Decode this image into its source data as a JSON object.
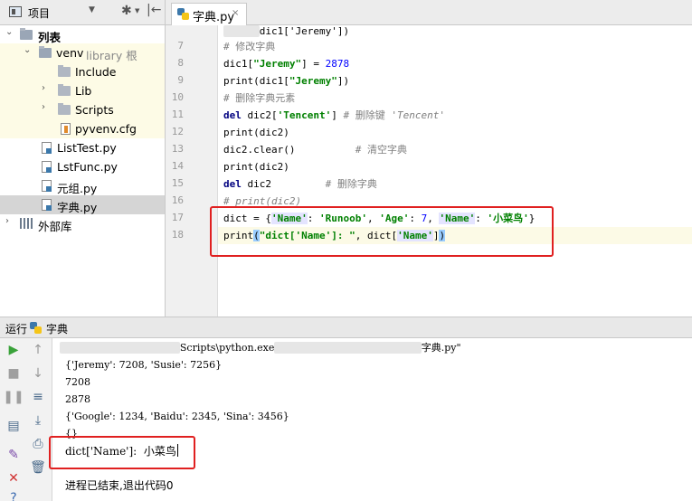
{
  "project_panel": {
    "title": "项目",
    "caret": "▼",
    "gear": "✱",
    "gear_caret": "▼",
    "pin": "|←"
  },
  "editor_tab": {
    "label": "字典.py",
    "close": "×"
  },
  "tree": {
    "root": "列表",
    "venv": "venv",
    "venv_hint": "library 根",
    "include": "Include",
    "lib": "Lib",
    "scripts": "Scripts",
    "cfg": "pyvenv.cfg",
    "files": [
      "ListTest.py",
      "LstFunc.py",
      "元组.py",
      "字典.py"
    ],
    "external": "外部库"
  },
  "editor": {
    "line_numbers": [
      "7",
      "8",
      "9",
      "10",
      "11",
      "12",
      "13",
      "14",
      "15",
      "16",
      "17",
      "18"
    ],
    "partial_top": "dic1['Jeremy'])",
    "comment_modify": "# 修改字典",
    "comment_delete_elem": "# 删除字典元素",
    "comment_delete_key": "# 删除键 ",
    "comment_delete_key_str": "'Tencent'",
    "comment_clear": "# 清空字典",
    "comment_delete_dict": "# 删除字典",
    "comment_print_dic2": "# print(dic2)",
    "str_jeremy": "\"Jeremy\"",
    "str_tencent": "'Tencent'",
    "num_2878": "2878",
    "name_cn": "'小菜鸟'",
    "print_label": "\"dict['Name']: \""
  },
  "run": {
    "label": "运行",
    "name": "字典",
    "cmd_tail": "Scripts\\python.exe",
    "cmd_file": "字典.py\"",
    "output": [
      "{'Jeremy': 7208, 'Susie': 7256}",
      "7208",
      "2878",
      "{'Google': 1234, 'Baidu': 2345, 'Sina': 3456}",
      "{}",
      "dict['Name']:  小菜鸟"
    ],
    "exit": "进程已结束,退出代码0"
  },
  "colors": {
    "keyword": "#000080",
    "string": "#008000",
    "number": "#0000ff",
    "comment": "#808080",
    "annotation_box": "#e02020",
    "current_line": "#fcfae6"
  }
}
